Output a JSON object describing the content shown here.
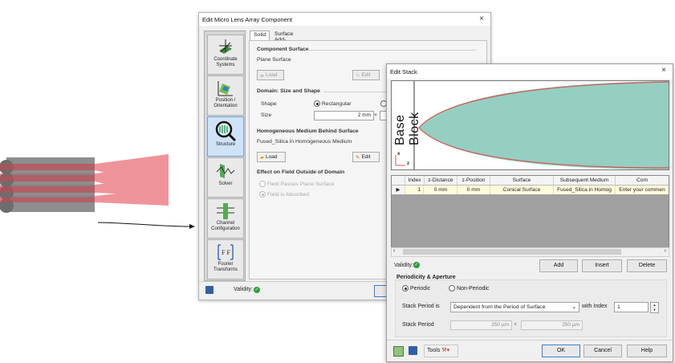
{
  "back_window": {
    "title": "Edit Micro Lens Array Component",
    "close": "×",
    "sidebar": [
      {
        "label_1": "Coordinate",
        "label_2": "Systems"
      },
      {
        "label_1": "Position /",
        "label_2": "Orientation"
      },
      {
        "label_1": "Structure",
        "label_2": ""
      },
      {
        "label_1": "Solver",
        "label_2": ""
      },
      {
        "label_1": "Channel",
        "label_2": "Configuration"
      },
      {
        "label_1": "Fourier",
        "label_2": "Transforms"
      }
    ],
    "tabs": [
      "Solid",
      "Surface Add-Ons"
    ],
    "component_surface": {
      "title": "Component Surface",
      "value": "Plane Surface",
      "load": "Load",
      "edit": "Edit"
    },
    "domain": {
      "title": "Domain: Size and Shape",
      "shape_label": "Shape",
      "shape_option": "Rectangular",
      "size_label": "Size",
      "size_value": "2 mm",
      "times": "×"
    },
    "medium": {
      "title": "Homogeneous Medium Behind Surface",
      "value": "Fused_Silica in Homogeneous Medium",
      "load": "Load",
      "edit": "Edit"
    },
    "effect": {
      "title": "Effect on Field Outside of Domain",
      "opt1": "Field Passes Plane Surface",
      "opt2": "Field is Absorbed"
    },
    "validity": "Validity:"
  },
  "front_window": {
    "title": "Edit Stack",
    "close": "×",
    "vis_label": "Base Block",
    "axis_x": "x",
    "axis_z": "z",
    "table": {
      "headers": [
        "Index",
        "z-Distance",
        "z-Position",
        "Surface",
        "Subsequent Medium",
        "Com"
      ],
      "row": [
        "1",
        "0 mm",
        "0 mm",
        "Conical Surface",
        "Fused_Silica in Homog",
        "Enter your commen"
      ]
    },
    "validity": "Validity:",
    "add": "Add",
    "insert": "Insert",
    "delete": "Delete",
    "periodicity": {
      "title": "Periodicity & Aperture",
      "periodic": "Periodic",
      "non_periodic": "Non-Periodic",
      "stack_period_is": "Stack Period is",
      "dropdown": "Dependent from the Period of Surface",
      "with_index": "with Index",
      "index_value": "1",
      "stack_period": "Stack Period",
      "p1": "250 µm",
      "times": "×",
      "p2": "250 µm"
    },
    "tools": "Tools",
    "ok": "OK",
    "cancel": "Cancel",
    "help": "Help"
  },
  "colors": {
    "accent": "#3c7fd1",
    "teal_fill": "#94cfc2",
    "surface_line": "#d9534f",
    "beam": "#e23b4a",
    "check": "#2e9e3e"
  }
}
